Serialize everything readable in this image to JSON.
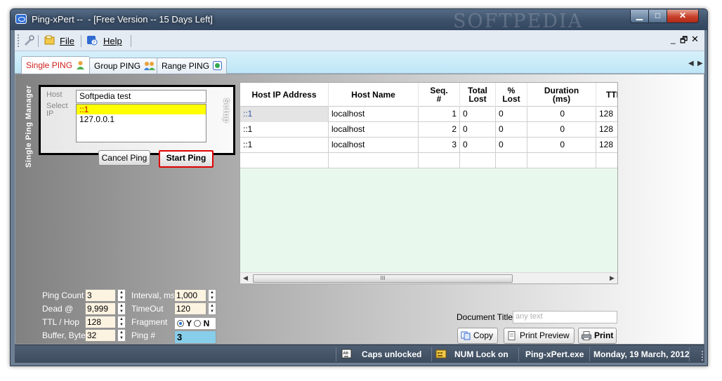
{
  "window": {
    "title": "Ping-xPert --  - [Free Version -- 15 Days Left]",
    "watermark": "SOFTPEDIA",
    "minimize": "▁",
    "maximize": "□",
    "close": "✕"
  },
  "menu": {
    "file": "File",
    "help": "Help",
    "mdi_min": "_",
    "mdi_restore": "🗗",
    "mdi_close": "✕"
  },
  "tabs": [
    {
      "label": "Single PING",
      "icon": "single-user-icon"
    },
    {
      "label": "Group PING",
      "icon": "group-users-icon"
    },
    {
      "label": "Range PING",
      "icon": "range-network-icon"
    }
  ],
  "tab_nav": {
    "prev": "◀",
    "next": "▶"
  },
  "setup": {
    "vertical_title": "Single Ping Manager",
    "setup_label": "Setup",
    "host_label": "Host",
    "select_label": "Select IP",
    "host_value": "Softpedia test",
    "host_list": [
      "::1",
      "127.0.0.1"
    ],
    "cancel_button": "Cancel Ping",
    "start_button": "Start Ping"
  },
  "grid": {
    "columns": [
      "Host IP Address",
      "Host Name",
      "Seq. #",
      "Total Lost",
      "% Lost",
      "Duration (ms)",
      "TTL"
    ],
    "rows": [
      {
        "ip": "::1",
        "name": "localhost",
        "seq": "1",
        "total_lost": "0",
        "pct_lost": "0",
        "duration": "0",
        "ttl": "128"
      },
      {
        "ip": "::1",
        "name": "localhost",
        "seq": "2",
        "total_lost": "0",
        "pct_lost": "0",
        "duration": "0",
        "ttl": "128"
      },
      {
        "ip": "::1",
        "name": "localhost",
        "seq": "3",
        "total_lost": "0",
        "pct_lost": "0",
        "duration": "0",
        "ttl": "128"
      }
    ],
    "scroll_grip": "III",
    "scroll_left": "◀",
    "scroll_right": "▶"
  },
  "params": {
    "ping_count_label": "Ping Count",
    "ping_count": "3",
    "dead_label": "Dead @",
    "dead": "9,999",
    "ttl_hop_label": "TTL / Hop",
    "ttl_hop": "128",
    "buffer_label": "Buffer, Byte",
    "buffer": "32",
    "interval_label": "Interval, ms",
    "interval": "1,000",
    "timeout_label": "TimeOut",
    "timeout": "120",
    "fragment_label": "Fragment",
    "fragment_yes": "Y",
    "fragment_no": "N",
    "fragment_selected": "Y",
    "ping_num_label": "Ping #",
    "ping_num": "3"
  },
  "document": {
    "title_label": "Document Title",
    "title_placeholder": "any text",
    "copy": "Copy",
    "print_preview": "Print Preview",
    "print": "Print"
  },
  "status": {
    "caps": "Caps unlocked",
    "num": "NUM Lock on",
    "exe": "Ping-xPert.exe",
    "date": "Monday, 19 March, 2012"
  }
}
